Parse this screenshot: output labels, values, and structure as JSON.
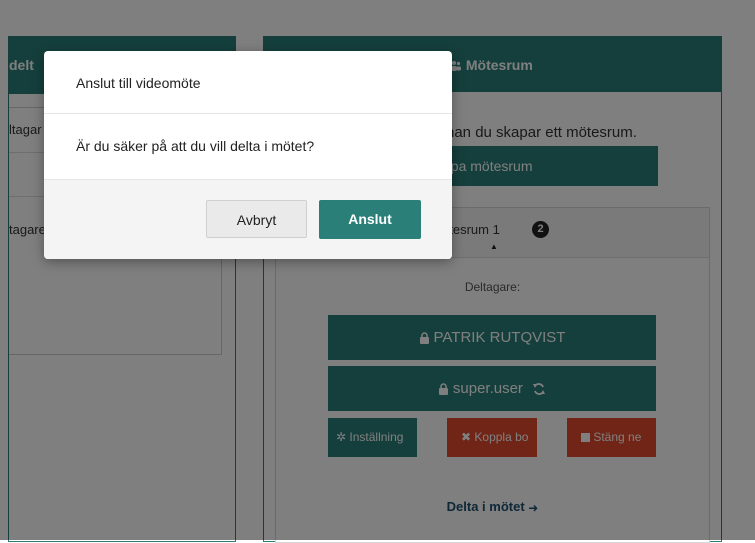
{
  "left_panel": {
    "header_title": "delt",
    "rows": [
      "ltagar",
      "",
      "tagare"
    ]
  },
  "right_panel": {
    "header_title": "Mötesrum",
    "info_text": "nan du skapar ett mötesrum.",
    "create_button": "kapa mötesrum",
    "room": {
      "name": "ötesrum 1",
      "badge": "2",
      "participants_label": "Deltagare:",
      "users": [
        "PATRIK RUTQVIST",
        "super.user"
      ],
      "buttons": {
        "settings": "Inställning",
        "disconnect": "Koppla bo",
        "close": "Stäng ne"
      },
      "join_link": "Delta i mötet"
    }
  },
  "modal": {
    "title": "Anslut till videomöte",
    "message": "Är du säker på att du vill delta i mötet?",
    "cancel_label": "Avbryt",
    "connect_label": "Anslut"
  },
  "colors": {
    "brand_teal": "#2b7f79",
    "danger_red": "#e24a2f",
    "overlay": "rgba(0,0,0,0.5)"
  },
  "icons": {
    "header": "users-icon",
    "lock": "lock-icon",
    "sync": "sync-icon",
    "settings": "gear-icon",
    "disconnect": "x-icon",
    "stop": "stop-icon",
    "join": "sign-in-icon"
  }
}
